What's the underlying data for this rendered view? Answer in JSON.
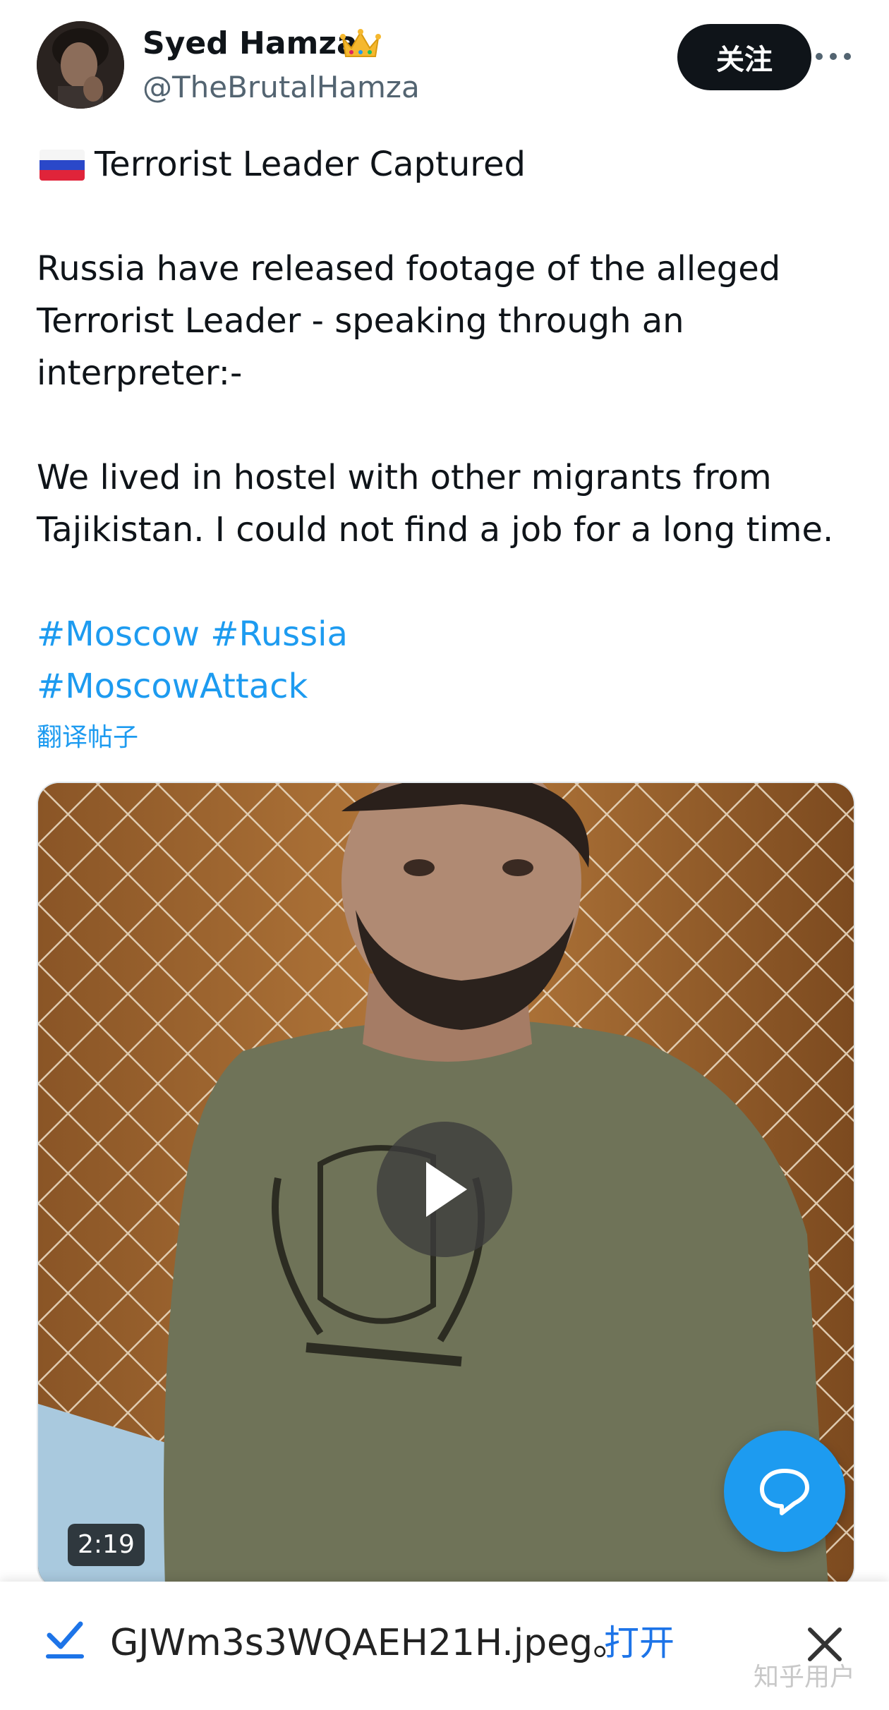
{
  "header": {
    "display_name": "Syed Hamza",
    "handle": "@TheBrutalHamza",
    "follow_label": "关注"
  },
  "tweet": {
    "headline": "Terrorist Leader Captured",
    "paragraph1": [
      "Russia have released footage of the alleged",
      "Terrorist Leader - speaking through an",
      "interpreter:-"
    ],
    "paragraph2": [
      "We lived in hostel with other migrants from",
      "Tajikistan. I could not find a job for a long time."
    ],
    "hashtags_line1": [
      "#Moscow",
      "#Russia"
    ],
    "hashtags_line2": [
      "#MoscowAttack"
    ],
    "translate_label": "翻译帖子"
  },
  "media": {
    "duration": "2:19"
  },
  "download_bar": {
    "filename": "GJWm3s3WQAEH21H.jpeg。",
    "open_label": "打开",
    "watermark": "知乎用户"
  },
  "colors": {
    "accent": "#1d9bf0",
    "text": "#0f1419",
    "secondary": "#536471",
    "follow_bg": "#0f1419"
  },
  "icons": [
    "crown-icon",
    "more-icon",
    "russia-flag-icon",
    "play-icon",
    "reply-icon",
    "download-check-icon",
    "close-icon"
  ]
}
